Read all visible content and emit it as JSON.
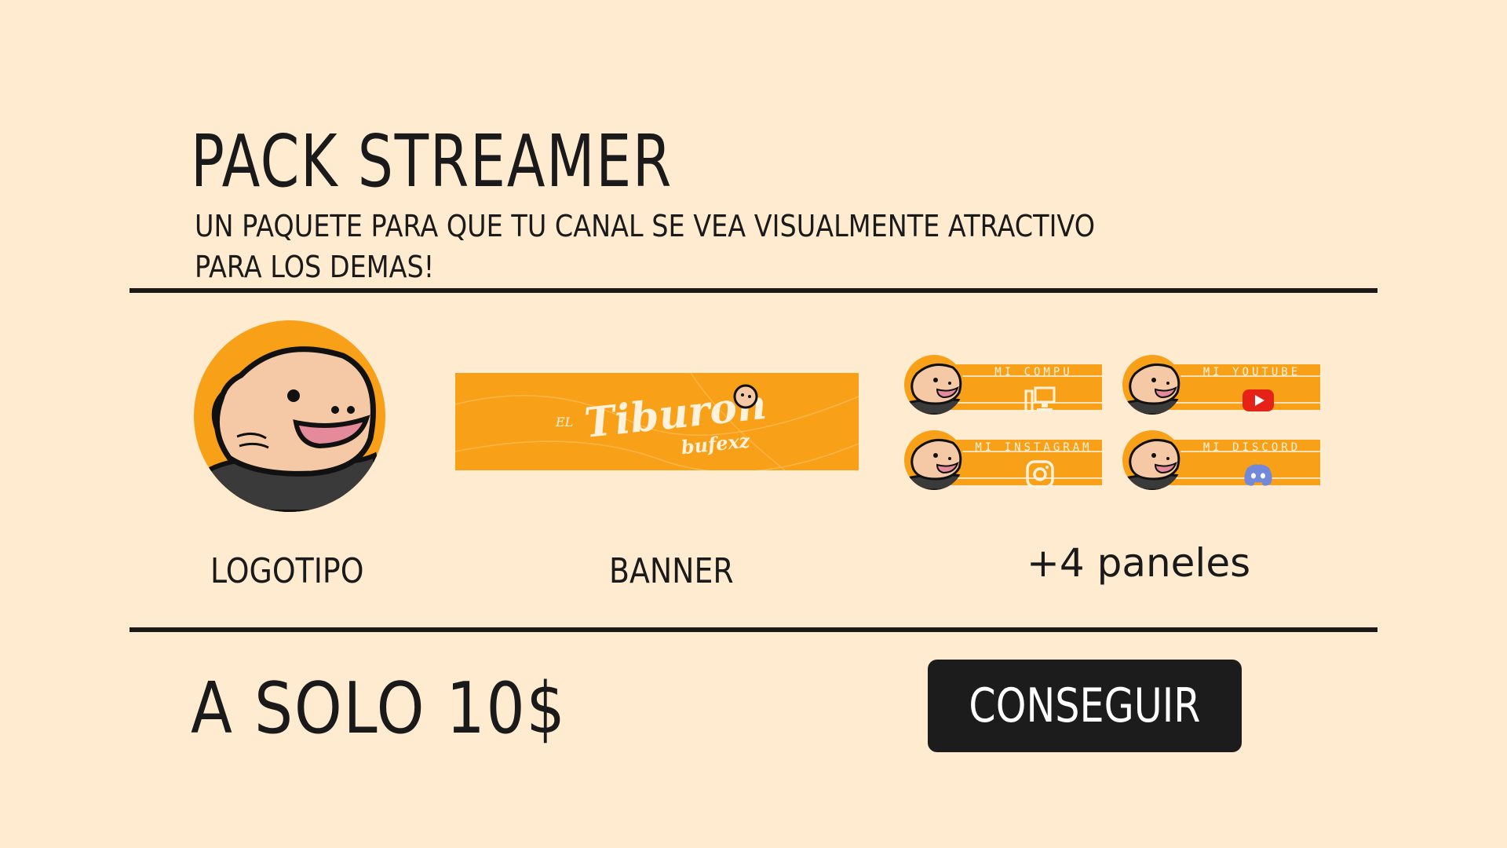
{
  "header": {
    "title": "PACK STREAMER",
    "subtitle": "UN PAQUETE PARA QUE TU CANAL SE VEA VISUALMENTE ATRACTIVO PARA LOS DEMAS!"
  },
  "items": {
    "logo_label": "LOGOTIPO",
    "banner_label": "BANNER",
    "panels_label": "+4 paneles"
  },
  "banner": {
    "prefix": "EL",
    "name": "Tiburon",
    "handle": "bufexz"
  },
  "panels": [
    {
      "title": "MI COMPU",
      "icon": "computer-icon"
    },
    {
      "title": "MI YOUTUBE",
      "icon": "youtube-icon"
    },
    {
      "title": "MI INSTAGRAM",
      "icon": "instagram-icon"
    },
    {
      "title": "MI DISCORD",
      "icon": "discord-icon"
    }
  ],
  "footer": {
    "price": "A SOLO 10$",
    "cta_label": "CONSEGUIR"
  },
  "colors": {
    "background": "#feebd0",
    "accent": "#f9a019",
    "dark": "#1a1a1a",
    "youtube_red": "#e62117",
    "discord_blue": "#7289da"
  }
}
